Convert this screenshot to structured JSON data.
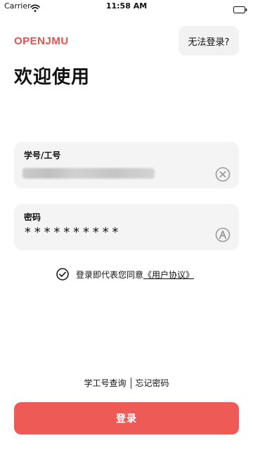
{
  "status_bar": {
    "carrier": "Carrier",
    "time": "11:58 AM",
    "wifi_icon": "wifi-icon",
    "battery_icon": "battery-icon"
  },
  "header": {
    "brand": "OPENJMU",
    "brand_color": "#e65050",
    "help_button_label": "无法登录?"
  },
  "main": {
    "title": "欢迎使用",
    "username_field": {
      "label": "学号/工号",
      "value": "",
      "clear_icon": "clear-circle-icon"
    },
    "password_field": {
      "label": "密码",
      "value": "**********",
      "toggle_icon": "password-visibility-icon"
    },
    "agreement": {
      "prefix": "登录即代表您同意",
      "link": "《用户协议》",
      "check_icon": "checkmark-circle-icon"
    }
  },
  "footer": {
    "query_id_label": "学工号查询",
    "forgot_password_label": "忘记密码",
    "login_button_label": "登录",
    "login_button_color": "#ee5b57"
  }
}
